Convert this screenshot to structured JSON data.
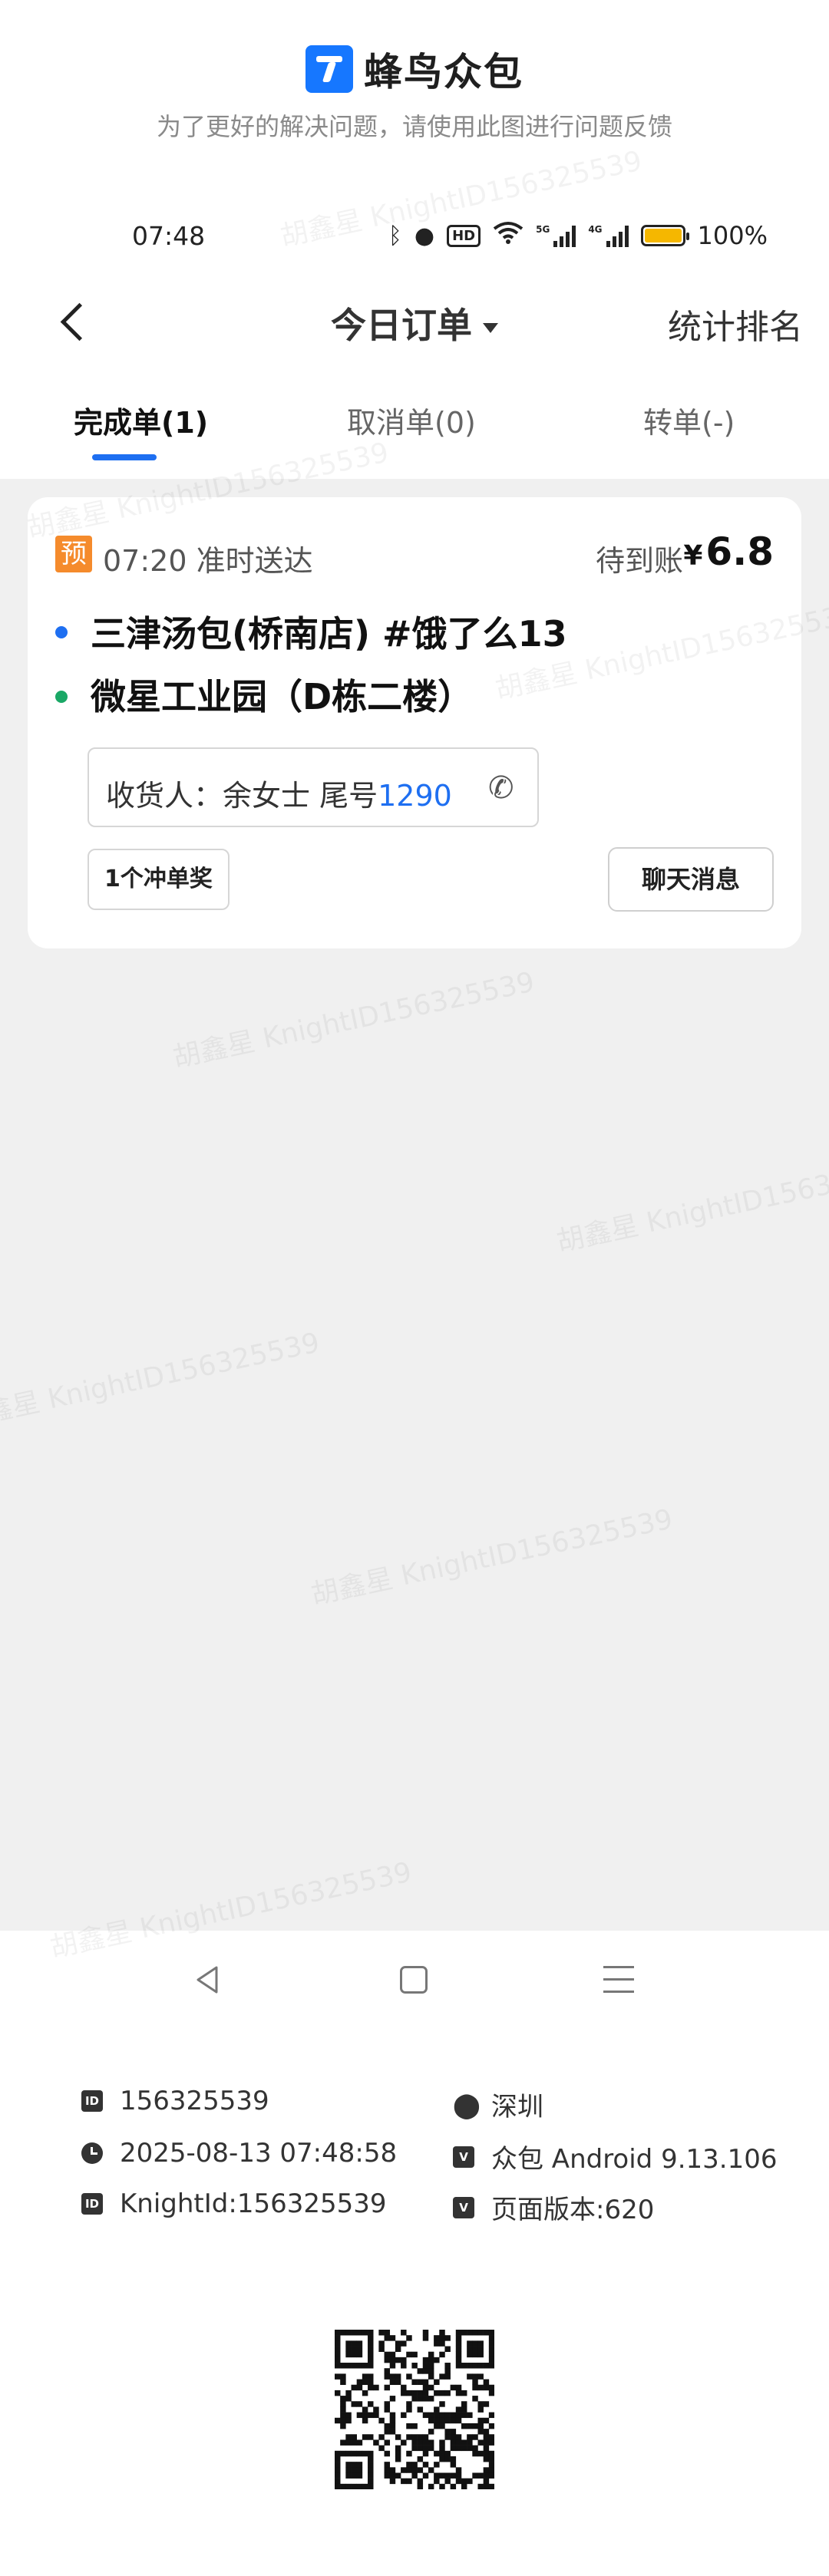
{
  "banner": {
    "app_name": "蜂鸟众包",
    "subtitle": "为了更好的解决问题，请使用此图进行问题反馈"
  },
  "status_bar": {
    "time": "07:48",
    "hd_label": "HD",
    "net_5g": "5G",
    "net_4g": "4G",
    "battery_pct": "100%",
    "battery_level": 1.0
  },
  "header": {
    "title": "今日订单",
    "right_action": "统计排名"
  },
  "tabs": [
    {
      "label": "完成单(1)",
      "active": true
    },
    {
      "label": "取消单(0)",
      "active": false
    },
    {
      "label": "转单(-)",
      "active": false
    }
  ],
  "order": {
    "badge": "预",
    "time_text": "07:20 准时送达",
    "status": "待到账",
    "currency": "¥",
    "amount": "6.8",
    "pickup": "三津汤包(桥南店) #饿了么13",
    "dropoff": "微星工业园（D栋二楼）",
    "receiver_label": "收货人：余女士 尾号",
    "receiver_tail": "1290",
    "chip_label": "1个冲单奖",
    "chat_label": "聊天消息",
    "pickup_dot_color": "#1e6ff1",
    "dropoff_dot_color": "#1aa866"
  },
  "info": {
    "id_icon": "ID",
    "id": "156325539",
    "city": "深圳",
    "datetime": "2025-08-13 07:48:58",
    "v_icon": "V",
    "app_version": "众包 Android 9.13.106",
    "knight_id": "KnightId:156325539",
    "page_version": "页面版本:620"
  },
  "watermark": "胡鑫星 KnightID156325539",
  "colors": {
    "accent": "#1e6ff1",
    "badge_orange": "#f58b2c",
    "battery": "#f5b700",
    "background_grey": "#f0f0f0"
  }
}
